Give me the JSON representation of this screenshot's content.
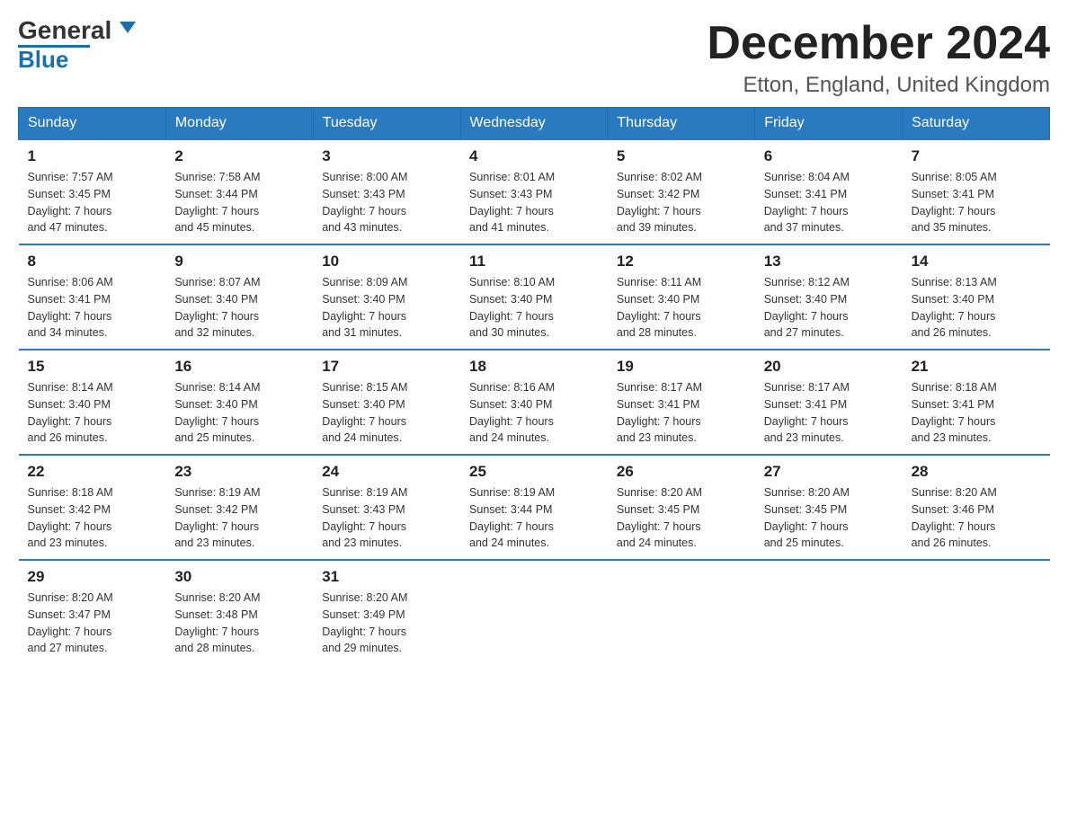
{
  "logo": {
    "text_general": "General",
    "text_blue": "Blue"
  },
  "title": "December 2024",
  "subtitle": "Etton, England, United Kingdom",
  "days_of_week": [
    "Sunday",
    "Monday",
    "Tuesday",
    "Wednesday",
    "Thursday",
    "Friday",
    "Saturday"
  ],
  "weeks": [
    [
      {
        "day": "1",
        "sunrise": "7:57 AM",
        "sunset": "3:45 PM",
        "daylight": "7 hours and 47 minutes."
      },
      {
        "day": "2",
        "sunrise": "7:58 AM",
        "sunset": "3:44 PM",
        "daylight": "7 hours and 45 minutes."
      },
      {
        "day": "3",
        "sunrise": "8:00 AM",
        "sunset": "3:43 PM",
        "daylight": "7 hours and 43 minutes."
      },
      {
        "day": "4",
        "sunrise": "8:01 AM",
        "sunset": "3:43 PM",
        "daylight": "7 hours and 41 minutes."
      },
      {
        "day": "5",
        "sunrise": "8:02 AM",
        "sunset": "3:42 PM",
        "daylight": "7 hours and 39 minutes."
      },
      {
        "day": "6",
        "sunrise": "8:04 AM",
        "sunset": "3:41 PM",
        "daylight": "7 hours and 37 minutes."
      },
      {
        "day": "7",
        "sunrise": "8:05 AM",
        "sunset": "3:41 PM",
        "daylight": "7 hours and 35 minutes."
      }
    ],
    [
      {
        "day": "8",
        "sunrise": "8:06 AM",
        "sunset": "3:41 PM",
        "daylight": "7 hours and 34 minutes."
      },
      {
        "day": "9",
        "sunrise": "8:07 AM",
        "sunset": "3:40 PM",
        "daylight": "7 hours and 32 minutes."
      },
      {
        "day": "10",
        "sunrise": "8:09 AM",
        "sunset": "3:40 PM",
        "daylight": "7 hours and 31 minutes."
      },
      {
        "day": "11",
        "sunrise": "8:10 AM",
        "sunset": "3:40 PM",
        "daylight": "7 hours and 30 minutes."
      },
      {
        "day": "12",
        "sunrise": "8:11 AM",
        "sunset": "3:40 PM",
        "daylight": "7 hours and 28 minutes."
      },
      {
        "day": "13",
        "sunrise": "8:12 AM",
        "sunset": "3:40 PM",
        "daylight": "7 hours and 27 minutes."
      },
      {
        "day": "14",
        "sunrise": "8:13 AM",
        "sunset": "3:40 PM",
        "daylight": "7 hours and 26 minutes."
      }
    ],
    [
      {
        "day": "15",
        "sunrise": "8:14 AM",
        "sunset": "3:40 PM",
        "daylight": "7 hours and 26 minutes."
      },
      {
        "day": "16",
        "sunrise": "8:14 AM",
        "sunset": "3:40 PM",
        "daylight": "7 hours and 25 minutes."
      },
      {
        "day": "17",
        "sunrise": "8:15 AM",
        "sunset": "3:40 PM",
        "daylight": "7 hours and 24 minutes."
      },
      {
        "day": "18",
        "sunrise": "8:16 AM",
        "sunset": "3:40 PM",
        "daylight": "7 hours and 24 minutes."
      },
      {
        "day": "19",
        "sunrise": "8:17 AM",
        "sunset": "3:41 PM",
        "daylight": "7 hours and 23 minutes."
      },
      {
        "day": "20",
        "sunrise": "8:17 AM",
        "sunset": "3:41 PM",
        "daylight": "7 hours and 23 minutes."
      },
      {
        "day": "21",
        "sunrise": "8:18 AM",
        "sunset": "3:41 PM",
        "daylight": "7 hours and 23 minutes."
      }
    ],
    [
      {
        "day": "22",
        "sunrise": "8:18 AM",
        "sunset": "3:42 PM",
        "daylight": "7 hours and 23 minutes."
      },
      {
        "day": "23",
        "sunrise": "8:19 AM",
        "sunset": "3:42 PM",
        "daylight": "7 hours and 23 minutes."
      },
      {
        "day": "24",
        "sunrise": "8:19 AM",
        "sunset": "3:43 PM",
        "daylight": "7 hours and 23 minutes."
      },
      {
        "day": "25",
        "sunrise": "8:19 AM",
        "sunset": "3:44 PM",
        "daylight": "7 hours and 24 minutes."
      },
      {
        "day": "26",
        "sunrise": "8:20 AM",
        "sunset": "3:45 PM",
        "daylight": "7 hours and 24 minutes."
      },
      {
        "day": "27",
        "sunrise": "8:20 AM",
        "sunset": "3:45 PM",
        "daylight": "7 hours and 25 minutes."
      },
      {
        "day": "28",
        "sunrise": "8:20 AM",
        "sunset": "3:46 PM",
        "daylight": "7 hours and 26 minutes."
      }
    ],
    [
      {
        "day": "29",
        "sunrise": "8:20 AM",
        "sunset": "3:47 PM",
        "daylight": "7 hours and 27 minutes."
      },
      {
        "day": "30",
        "sunrise": "8:20 AM",
        "sunset": "3:48 PM",
        "daylight": "7 hours and 28 minutes."
      },
      {
        "day": "31",
        "sunrise": "8:20 AM",
        "sunset": "3:49 PM",
        "daylight": "7 hours and 29 minutes."
      },
      null,
      null,
      null,
      null
    ]
  ],
  "labels": {
    "sunrise": "Sunrise: ",
    "sunset": "Sunset: ",
    "daylight": "Daylight: "
  }
}
